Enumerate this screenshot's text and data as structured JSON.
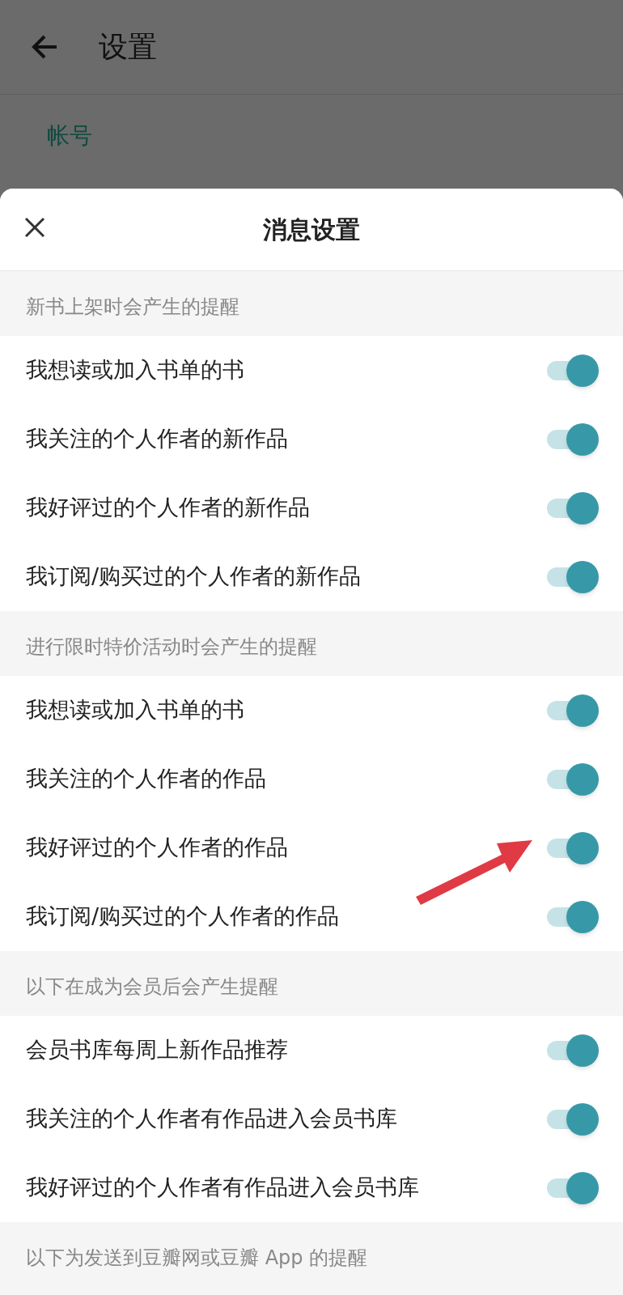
{
  "background_page": {
    "title": "设置",
    "section": "帐号"
  },
  "sheet": {
    "title": "消息设置"
  },
  "sections": [
    {
      "header": "新书上架时会产生的提醒",
      "items": [
        {
          "label": "我想读或加入书单的书",
          "on": true
        },
        {
          "label": "我关注的个人作者的新作品",
          "on": true
        },
        {
          "label": "我好评过的个人作者的新作品",
          "on": true
        },
        {
          "label": "我订阅/购买过的个人作者的新作品",
          "on": true
        }
      ]
    },
    {
      "header": "进行限时特价活动时会产生的提醒",
      "items": [
        {
          "label": "我想读或加入书单的书",
          "on": true
        },
        {
          "label": "我关注的个人作者的作品",
          "on": true
        },
        {
          "label": "我好评过的个人作者的作品",
          "on": true
        },
        {
          "label": "我订阅/购买过的个人作者的作品",
          "on": true
        }
      ]
    },
    {
      "header": "以下在成为会员后会产生提醒",
      "items": [
        {
          "label": "会员书库每周上新作品推荐",
          "on": true
        },
        {
          "label": "我关注的个人作者有作品进入会员书库",
          "on": true
        },
        {
          "label": "我好评过的个人作者有作品进入会员书库",
          "on": true
        }
      ]
    },
    {
      "header": "以下为发送到豆瓣网或豆瓣 App 的提醒"
    }
  ]
}
